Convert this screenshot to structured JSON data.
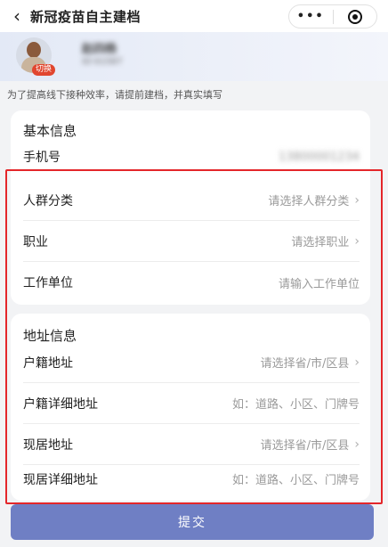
{
  "nav": {
    "back_glyph": "‹",
    "title": "新冠疫苗自主建档",
    "more_glyph": "•••",
    "icons": [
      "back-icon",
      "more-icon",
      "close-icon"
    ]
  },
  "user": {
    "name": "赵四杨",
    "id_text": "ID·01587",
    "switch_label": "切换"
  },
  "notice": "为了提高线下接种效率，请提前建档，并真实填写",
  "basic": {
    "title": "基本信息",
    "phone_label": "手机号",
    "phone_value": "13800001234",
    "rows": [
      {
        "label": "人群分类",
        "placeholder": "请选择人群分类",
        "chevron": "›"
      },
      {
        "label": "职业",
        "placeholder": "请选择职业",
        "chevron": "›"
      },
      {
        "label": "工作单位",
        "placeholder": "请输入工作单位",
        "chevron": ""
      }
    ]
  },
  "address": {
    "title": "地址信息",
    "rows": [
      {
        "label": "户籍地址",
        "placeholder": "请选择省/市/区县",
        "chevron": "›"
      },
      {
        "label": "户籍详细地址",
        "placeholder": "如：道路、小区、门牌号",
        "chevron": ""
      },
      {
        "label": "现居地址",
        "placeholder": "请选择省/市/区县",
        "chevron": "›"
      },
      {
        "label": "现居详细地址",
        "placeholder": "如：道路、小区、门牌号",
        "chevron": ""
      }
    ]
  },
  "submit_label": "提交",
  "colors": {
    "highlight": "#e4262a",
    "submit_bg": "#6f7fc4",
    "switch_tag": "#e1462f"
  }
}
